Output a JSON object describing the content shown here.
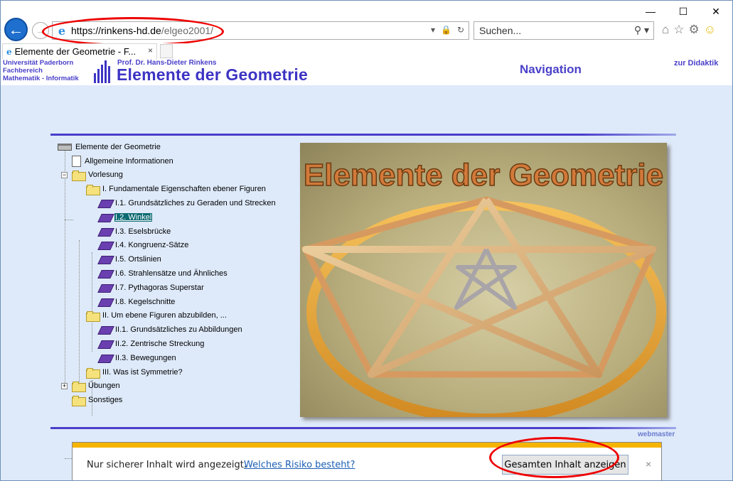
{
  "browser": {
    "url_host": "https://rinkens-hd.de",
    "url_path": "/elgeo2001/",
    "search_placeholder": "Suchen...",
    "tab_title": "Elemente der Geometrie - F...",
    "tab_close": "×"
  },
  "header": {
    "uni_line1": "Universität Paderborn",
    "uni_line2": "Fachbereich",
    "uni_line3": "Mathematik - Informatik",
    "prof": "Prof. Dr. Hans-Dieter Rinkens",
    "title": "Elemente der Geometrie",
    "navigation": "Navigation",
    "didaktik": "zur Didaktik"
  },
  "tree": {
    "root": "Elemente der Geometrie",
    "allg": "Allgemeine Informationen",
    "vorlesung": "Vorlesung",
    "ch1": "I. Fundamentale Eigenschaften ebener Figuren",
    "ch1_items": [
      "I.1. Grundsätzliches zu Geraden und Strecken",
      "I.2. Winkel",
      "I.3. Eselsbrücke",
      "I.4. Kongruenz-Sätze",
      "I.5. Ortslinien",
      "I.6. Strahlensätze und Ähnliches",
      "I.7. Pythagoras Superstar",
      "I.8. Kegelschnitte"
    ],
    "ch2": "II. Um ebene Figuren abzubilden, ...",
    "ch2_items": [
      "II.1. Grundsätzliches zu Abbildungen",
      "II.2. Zentrische Streckung",
      "II.3. Bewegungen"
    ],
    "ch3": "III. Was ist Symmetrie?",
    "uebungen": "Übungen",
    "sonstiges": "Sonstiges",
    "selected": "I.2. Winkel"
  },
  "hero": {
    "title_text": "Elemente der Geometrie"
  },
  "footer": {
    "webmaster": "webmaster"
  },
  "security_bar": {
    "message": "Nur sicherer Inhalt wird angezeigt.",
    "link": "Welches Risiko besteht?",
    "button": "Gesamten Inhalt anzeigen",
    "close": "×"
  },
  "colors": {
    "site_blue": "#3d34c4",
    "page_bg": "#deeafa",
    "warning_yellow": "#f5b400",
    "annotation_red": "#e00000"
  }
}
